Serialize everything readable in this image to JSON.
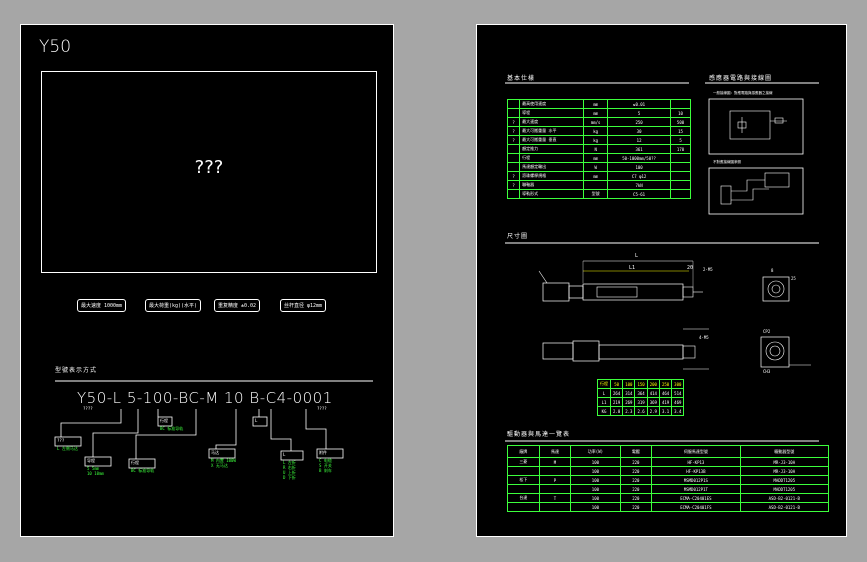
{
  "left": {
    "model_title": "Y50",
    "image_placeholder": "???",
    "spec_pills": [
      "最大速度 1000mm",
      "最大荷重(kg)(水平)",
      "重复精度 ±0.02",
      "丝杆直径 φ12mm"
    ],
    "ordering_title": "型號表示方式",
    "code_parts": [
      "Y50-",
      "L",
      " ",
      "5",
      "-",
      "100",
      "-",
      "BC",
      "-",
      "M",
      " ",
      "10",
      " ",
      "B",
      "-",
      "C4-0001"
    ],
    "code_sub": "????",
    "code_sub2": "????",
    "note_groups": [
      {
        "title": "???",
        "lines": [
          "L 左侧马达"
        ]
      },
      {
        "title": "导程",
        "lines": [
          "5 5mm",
          "10 10mm"
        ]
      },
      {
        "title": "行程",
        "lines": [
          "BC 标准导轨"
        ]
      },
      {
        "title": "马达",
        "lines": [
          "M 内置 100W",
          "X 无马达"
        ]
      },
      {
        "title": "L",
        "lines": [
          "L 左折",
          "R 右折",
          "U 上折",
          "D 下折"
        ]
      },
      {
        "title": "附件",
        "lines": [
          "C 电缆",
          "S 开关",
          "B 刹车"
        ]
      },
      {
        "title": "???",
        "lines": [
          "C4 伺服"
        ]
      }
    ]
  },
  "right": {
    "section1_title": "基本仕樣",
    "section2_title": "感應器電路與接線圖",
    "section3_title": "尺寸圖",
    "section4_title": "驅動器與馬達一覽表",
    "wiring_note1": "一般接線圖：對應電路與感應器之接線",
    "wiring_note2": "不對應接線圖參照",
    "spec_rows": [
      [
        "",
        "最高使用速度",
        "mm",
        "≤0.01",
        ""
      ],
      [
        "",
        "導程",
        "mm",
        "5",
        "10"
      ],
      [
        "?",
        "最大速度",
        "mm/s",
        "250",
        "500"
      ],
      [
        "?",
        "最大可搬重量 水平",
        "kg",
        "30",
        "15"
      ],
      [
        "?",
        "最大可搬重量 垂直",
        "kg",
        "12",
        "5"
      ],
      [
        "",
        "額定推力",
        "N",
        "361",
        "170"
      ],
      [
        "",
        "行程",
        "mm",
        "50-1000mm/50??",
        ""
      ],
      [
        "",
        "馬達額定輸出",
        "W",
        "100",
        ""
      ],
      [
        "?",
        "滾珠螺桿規格",
        "mm",
        "C7 φ12",
        ""
      ],
      [
        "?",
        "聯軸器",
        "",
        "7kN",
        ""
      ],
      [
        "",
        "導軌形式",
        "型號",
        "C5-61",
        ""
      ]
    ],
    "dims_labels": {
      "L": "L",
      "L1": "L1",
      "d1": "20",
      "d2": "2-M5",
      "d3": "8",
      "d4": "25",
      "d5": "4-M5",
      "d6": "CP2",
      "d7": "CH3"
    },
    "dim_table": {
      "header": [
        "行程",
        "50",
        "100",
        "150",
        "200",
        "250",
        "300"
      ],
      "rows": [
        [
          "L",
          "264",
          "314",
          "364",
          "414",
          "464",
          "514"
        ],
        [
          "L1",
          "219",
          "269",
          "319",
          "369",
          "419",
          "469"
        ],
        [
          "KG",
          "2.0",
          "2.3",
          "2.6",
          "2.9",
          "3.1",
          "3.4"
        ]
      ]
    },
    "motor_table": {
      "header": [
        "廠牌",
        "馬達",
        "功率(W)",
        "電壓",
        "伺服馬達型號",
        "驅動器型號"
      ],
      "rows": [
        [
          "三菱",
          "M",
          "100",
          "220",
          "HF-KP13",
          "MR-J3-10A"
        ],
        [
          "",
          "",
          "100",
          "220",
          "HF-KP13B",
          "MR-J3-10A"
        ],
        [
          "松下",
          "P",
          "100",
          "220",
          "MSMD012P1S",
          "MADDT1205"
        ],
        [
          "",
          "",
          "100",
          "220",
          "MSMD012P1T",
          "MADDT1205"
        ],
        [
          "台達",
          "T",
          "100",
          "220",
          "ECMA-C20401ES",
          "ASD-B2-0121-B"
        ],
        [
          "",
          "",
          "100",
          "220",
          "ECMA-C20401FS",
          "ASD-B2-0121-B"
        ]
      ]
    }
  }
}
